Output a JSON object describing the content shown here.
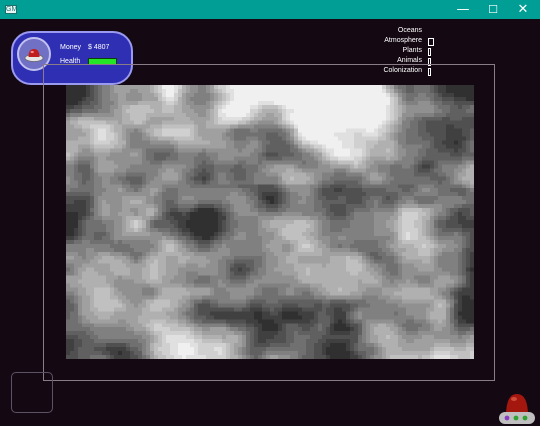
{
  "window": {
    "icon_text": "GM",
    "controls": {
      "minimize": "—",
      "maximize": "☐",
      "close": "✕"
    }
  },
  "hud": {
    "money_label": "Money",
    "money_value": "$ 4807",
    "health_label": "Health",
    "health_fraction": 1.0
  },
  "status": {
    "items": [
      {
        "label": "Oceans",
        "level": 0
      },
      {
        "label": "Atmosphere",
        "level": 0.15
      },
      {
        "label": "Plants",
        "level": 0.05
      },
      {
        "label": "Animals",
        "level": 0.05
      },
      {
        "label": "Colonization",
        "level": 0.05
      }
    ]
  },
  "colors": {
    "titlebar": "#009e94",
    "background": "#140912",
    "hud_fill": "#2f2fb3",
    "health": "#25e625"
  },
  "icons": {
    "avatar": "ufo-dome-icon",
    "corner": "alien-ship-icon"
  }
}
